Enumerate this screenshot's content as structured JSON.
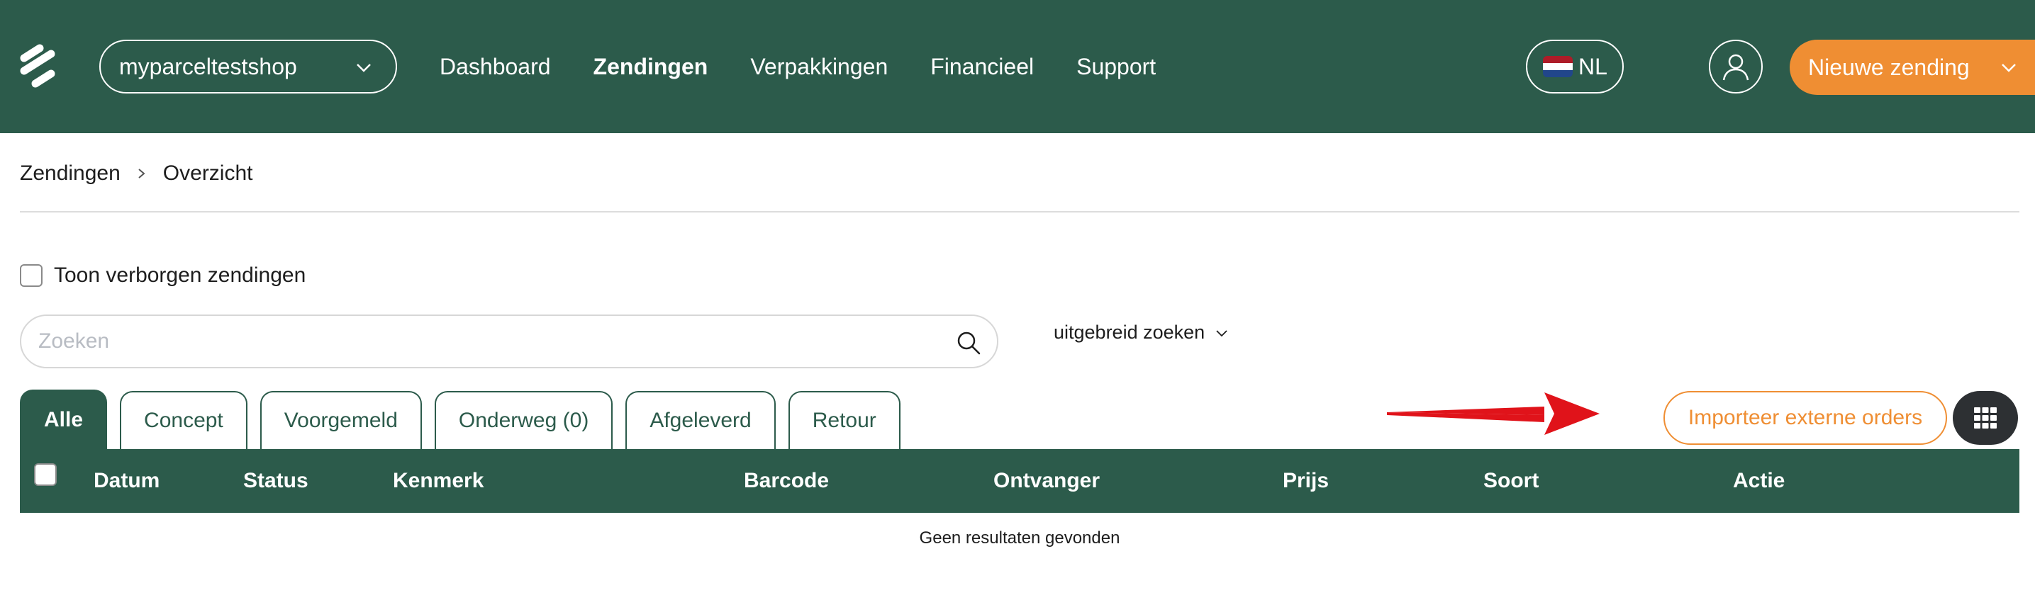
{
  "header": {
    "shop_name": "myparceltestshop",
    "nav": [
      "Dashboard",
      "Zendingen",
      "Verpakkingen",
      "Financieel",
      "Support"
    ],
    "active_nav": "Zendingen",
    "language": "NL",
    "new_shipment_label": "Nieuwe zending"
  },
  "breadcrumb": {
    "items": [
      "Zendingen",
      "Overzicht"
    ]
  },
  "filters": {
    "show_hidden_label": "Toon verborgen zendingen",
    "search_placeholder": "Zoeken",
    "advanced_search_label": "uitgebreid zoeken"
  },
  "tabs": [
    "Alle",
    "Concept",
    "Voorgemeld",
    "Onderweg (0)",
    "Afgeleverd",
    "Retour"
  ],
  "active_tab": "Alle",
  "actions": {
    "import_label": "Importeer externe orders"
  },
  "table": {
    "columns": [
      "Datum",
      "Status",
      "Kenmerk",
      "Barcode",
      "Ontvanger",
      "Prijs",
      "Soort",
      "Actie"
    ],
    "empty_message": "Geen resultaten gevonden"
  },
  "colors": {
    "brand_green": "#2c5b4b",
    "accent_orange": "#ef8e33",
    "arrow_red": "#e0131a"
  },
  "icons": {
    "logo": "myparcel-logo-icon",
    "chevron": "chevron-down-icon",
    "account": "user-icon",
    "search": "search-icon",
    "grid": "grid-icon",
    "arrow": "red-arrow-icon"
  }
}
